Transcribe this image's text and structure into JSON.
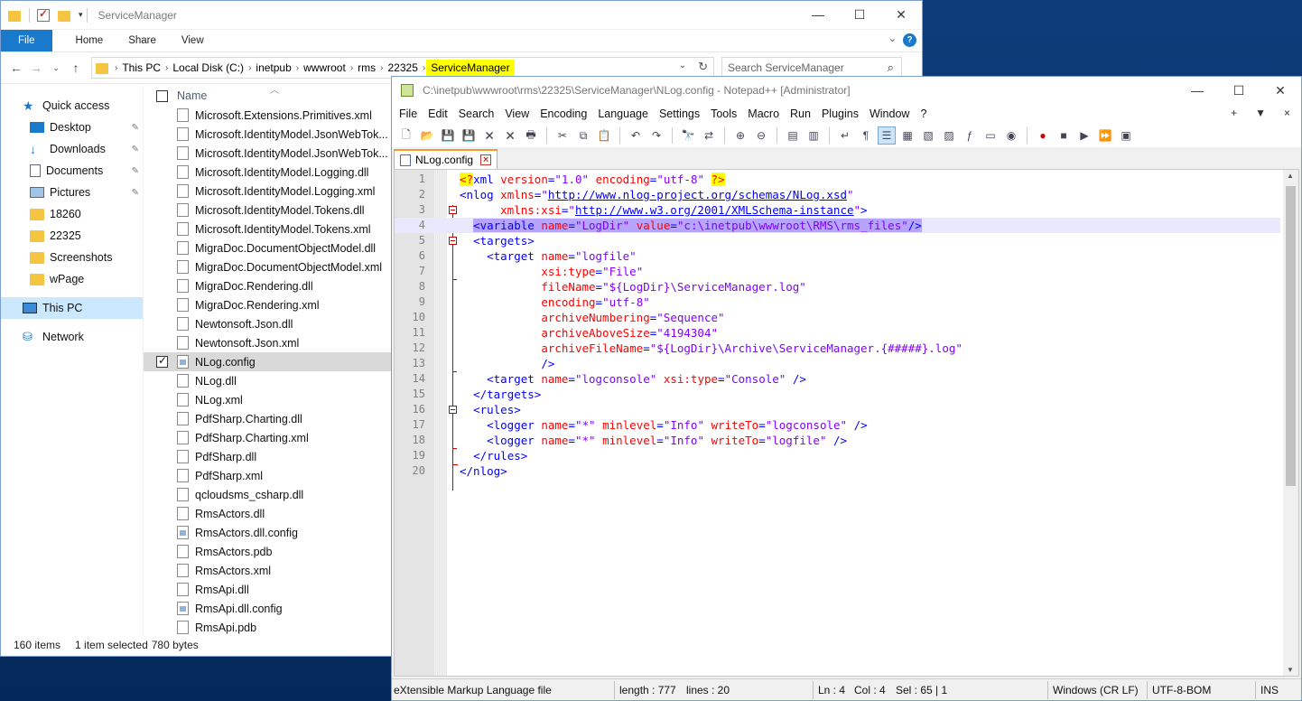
{
  "explorer": {
    "title": "ServiceManager",
    "ribbon_tabs": [
      "File",
      "Home",
      "Share",
      "View"
    ],
    "help_label": "?",
    "breadcrumbs": [
      "This PC",
      "Local Disk (C:)",
      "inetpub",
      "wwwroot",
      "rms",
      "22325",
      "ServiceManager"
    ],
    "search_placeholder": "Search ServiceManager",
    "nav": {
      "quick_access": "Quick access",
      "items": [
        "Desktop",
        "Downloads",
        "Documents",
        "Pictures",
        "18260",
        "22325",
        "Screenshots",
        "wPage"
      ],
      "this_pc": "This PC",
      "network": "Network"
    },
    "column_header": "Name",
    "files": [
      "Microsoft.Extensions.Primitives.xml",
      "Microsoft.IdentityModel.JsonWebTok...",
      "Microsoft.IdentityModel.JsonWebTok...",
      "Microsoft.IdentityModel.Logging.dll",
      "Microsoft.IdentityModel.Logging.xml",
      "Microsoft.IdentityModel.Tokens.dll",
      "Microsoft.IdentityModel.Tokens.xml",
      "MigraDoc.DocumentObjectModel.dll",
      "MigraDoc.DocumentObjectModel.xml",
      "MigraDoc.Rendering.dll",
      "MigraDoc.Rendering.xml",
      "Newtonsoft.Json.dll",
      "Newtonsoft.Json.xml",
      "NLog.config",
      "NLog.dll",
      "NLog.xml",
      "PdfSharp.Charting.dll",
      "PdfSharp.Charting.xml",
      "PdfSharp.dll",
      "PdfSharp.xml",
      "qcloudsms_csharp.dll",
      "RmsActors.dll",
      "RmsActors.dll.config",
      "RmsActors.pdb",
      "RmsActors.xml",
      "RmsApi.dll",
      "RmsApi.dll.config",
      "RmsApi.pdb"
    ],
    "selected_file": "NLog.config",
    "status": {
      "items": "160 items",
      "selected": "1 item selected",
      "size": "780 bytes"
    }
  },
  "npp": {
    "title": "C:\\inetpub\\wwwroot\\rms\\22325\\ServiceManager\\NLog.config - Notepad++ [Administrator]",
    "menu": [
      "File",
      "Edit",
      "Search",
      "View",
      "Encoding",
      "Language",
      "Settings",
      "Tools",
      "Macro",
      "Run",
      "Plugins",
      "Window",
      "?"
    ],
    "menu_right": [
      "+",
      "▼",
      "×"
    ],
    "tab": "NLog.config",
    "line_numbers": [
      "1",
      "2",
      "3",
      "4",
      "5",
      "6",
      "7",
      "8",
      "9",
      "10",
      "11",
      "12",
      "13",
      "14",
      "15",
      "16",
      "17",
      "18",
      "19",
      "20"
    ],
    "code": {
      "l1": {
        "open": "<?",
        "tag": "xml",
        "a1": "version",
        "eq1": "=",
        "v1": "\"1.0\"",
        "a2": "encoding",
        "eq2": "=",
        "v2": "\"utf-8\"",
        "close": "?>"
      },
      "l2": {
        "tag": "<nlog",
        "a1": "xmlns",
        "eq": "=",
        "q1": "\"",
        "url": "http://www.nlog-project.org/schemas/NLog.xsd",
        "q2": "\""
      },
      "l3": {
        "indent": "      ",
        "a1": "xmlns:xsi",
        "eq": "=",
        "q1": "\"",
        "url": "http://www.w3.org/2001/XMLSchema-instance",
        "q2": "\"",
        "close": ">"
      },
      "l4": {
        "indent": "  ",
        "tag": "<variable",
        "a1": "name",
        "eq1": "=",
        "v1": "\"LogDir\"",
        "a2": "value",
        "eq2": "=",
        "v2": "\"c:\\inetpub\\wwwroot\\RMS\\rms_files\"",
        "close": "/>"
      },
      "l5": {
        "indent": "  ",
        "tag": "<targets>"
      },
      "l6": {
        "indent": "    ",
        "tag": "<target",
        "a1": "name",
        "eq": "=",
        "v1": "\"logfile\""
      },
      "l7": {
        "indent": "            ",
        "a1": "xsi:type",
        "eq": "=",
        "v1": "\"File\""
      },
      "l8": {
        "indent": "            ",
        "a1": "fileName",
        "eq": "=",
        "v1": "\"${LogDir}\\ServiceManager.log\""
      },
      "l9": {
        "indent": "            ",
        "a1": "encoding",
        "eq": "=",
        "v1": "\"utf-8\""
      },
      "l10": {
        "indent": "            ",
        "a1": "archiveNumbering",
        "eq": "=",
        "v1": "\"Sequence\""
      },
      "l11": {
        "indent": "            ",
        "a1": "archiveAboveSize",
        "eq": "=",
        "v1": "\"4194304\""
      },
      "l12": {
        "indent": "            ",
        "a1": "archiveFileName",
        "eq": "=",
        "v1": "\"${LogDir}\\Archive\\ServiceManager.{#####}.log\""
      },
      "l13": {
        "indent": "            ",
        "close": "/>"
      },
      "l14": {
        "indent": "    ",
        "tag": "<target",
        "a1": "name",
        "eq1": "=",
        "v1": "\"logconsole\"",
        "a2": "xsi:type",
        "eq2": "=",
        "v2": "\"Console\"",
        "close": "/>"
      },
      "l15": {
        "indent": "  ",
        "tag": "</targets>"
      },
      "l16": {
        "indent": "  ",
        "tag": "<rules>"
      },
      "l17": {
        "indent": "    ",
        "tag": "<logger",
        "a1": "name",
        "eq1": "=",
        "v1": "\"*\"",
        "a2": "minlevel",
        "eq2": "=",
        "v2": "\"Info\"",
        "a3": "writeTo",
        "eq3": "=",
        "v3": "\"logconsole\"",
        "close": "/>"
      },
      "l18": {
        "indent": "    ",
        "tag": "<logger",
        "a1": "name",
        "eq1": "=",
        "v1": "\"*\"",
        "a2": "minlevel",
        "eq2": "=",
        "v2": "\"Info\"",
        "a3": "writeTo",
        "eq3": "=",
        "v3": "\"logfile\"",
        "close": "/>"
      },
      "l19": {
        "indent": "  ",
        "tag": "</rules>"
      },
      "l20": {
        "tag": "</nlog>"
      }
    },
    "status": {
      "type": "eXtensible Markup Language file",
      "length": "length : 777",
      "lines": "lines : 20",
      "ln": "Ln : 4",
      "col": "Col : 4",
      "sel": "Sel : 65 | 1",
      "eol": "Windows (CR LF)",
      "enc": "UTF-8-BOM",
      "ins": "INS"
    }
  }
}
